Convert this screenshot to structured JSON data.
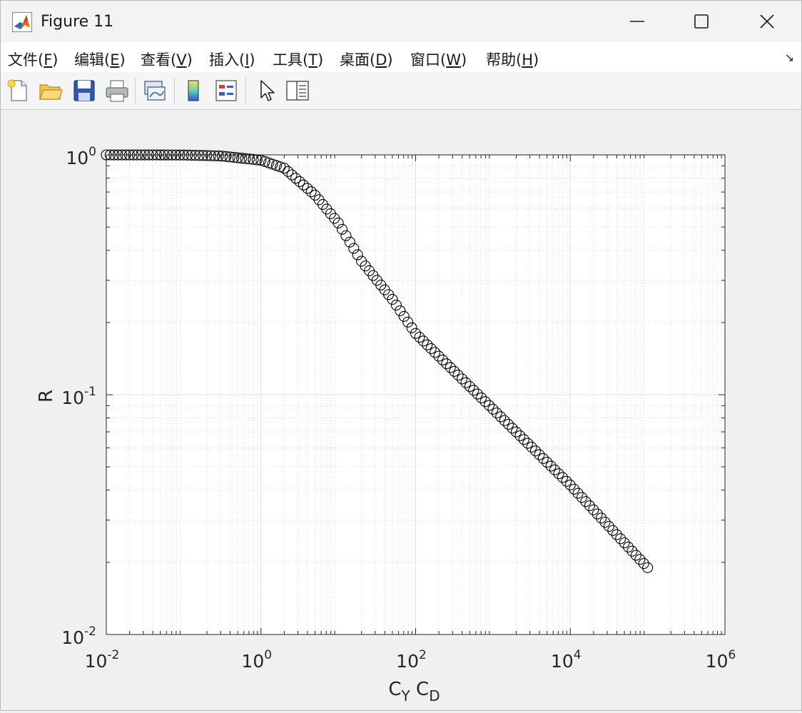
{
  "window": {
    "title": "Figure 11"
  },
  "menu": {
    "items": [
      {
        "label": "文件(",
        "key": "F",
        "end": ")"
      },
      {
        "label": "编辑(",
        "key": "E",
        "end": ")"
      },
      {
        "label": "查看(",
        "key": "V",
        "end": ")"
      },
      {
        "label": "插入(",
        "key": "I",
        "end": ")"
      },
      {
        "label": "工具(",
        "key": "T",
        "end": ")"
      },
      {
        "label": "桌面(",
        "key": "D",
        "end": ")"
      },
      {
        "label": "窗口(",
        "key": "W",
        "end": ")"
      },
      {
        "label": "帮助(",
        "key": "H",
        "end": ")"
      }
    ],
    "overflow_icon": "dock-arrow-icon"
  },
  "toolbar": {
    "icons": [
      "new-figure-icon",
      "open-file-icon",
      "save-icon",
      "print-icon",
      "link-plot-icon",
      "colorbar-icon",
      "legend-icon",
      "pointer-icon",
      "property-inspector-icon"
    ]
  },
  "chart_data": {
    "type": "scatter",
    "marker": "open-circle",
    "marker_color": "#000000",
    "xlabel_main": "C",
    "xlabel_sub1": "Y",
    "xlabel_mid": " C",
    "xlabel_sub2": "D",
    "ylabel": "R",
    "xscale": "log",
    "yscale": "log",
    "xlim": [
      0.01,
      1000000
    ],
    "ylim": [
      0.01,
      1
    ],
    "grid": true,
    "minor_grid": true,
    "x_ticks": [
      {
        "base": "10",
        "exp": "-2"
      },
      {
        "base": "10",
        "exp": "0"
      },
      {
        "base": "10",
        "exp": "2"
      },
      {
        "base": "10",
        "exp": "4"
      },
      {
        "base": "10",
        "exp": "6"
      }
    ],
    "y_ticks": [
      {
        "base": "10",
        "exp": "-2"
      },
      {
        "base": "10",
        "exp": "-1"
      },
      {
        "base": "10",
        "exp": "0"
      }
    ],
    "series": [
      {
        "x_range": [
          0.01,
          100000
        ],
        "point_count": 141,
        "spacing": "log",
        "sample_points": [
          [
            0.01,
            1.0
          ],
          [
            0.1,
            0.999
          ],
          [
            0.3,
            0.99
          ],
          [
            1.0,
            0.95
          ],
          [
            2.0,
            0.88
          ],
          [
            5.0,
            0.68
          ],
          [
            10,
            0.52
          ],
          [
            20,
            0.36
          ],
          [
            50,
            0.25
          ],
          [
            100,
            0.18
          ],
          [
            1000,
            0.087
          ],
          [
            10000,
            0.042
          ],
          [
            100000,
            0.019
          ]
        ]
      }
    ]
  }
}
